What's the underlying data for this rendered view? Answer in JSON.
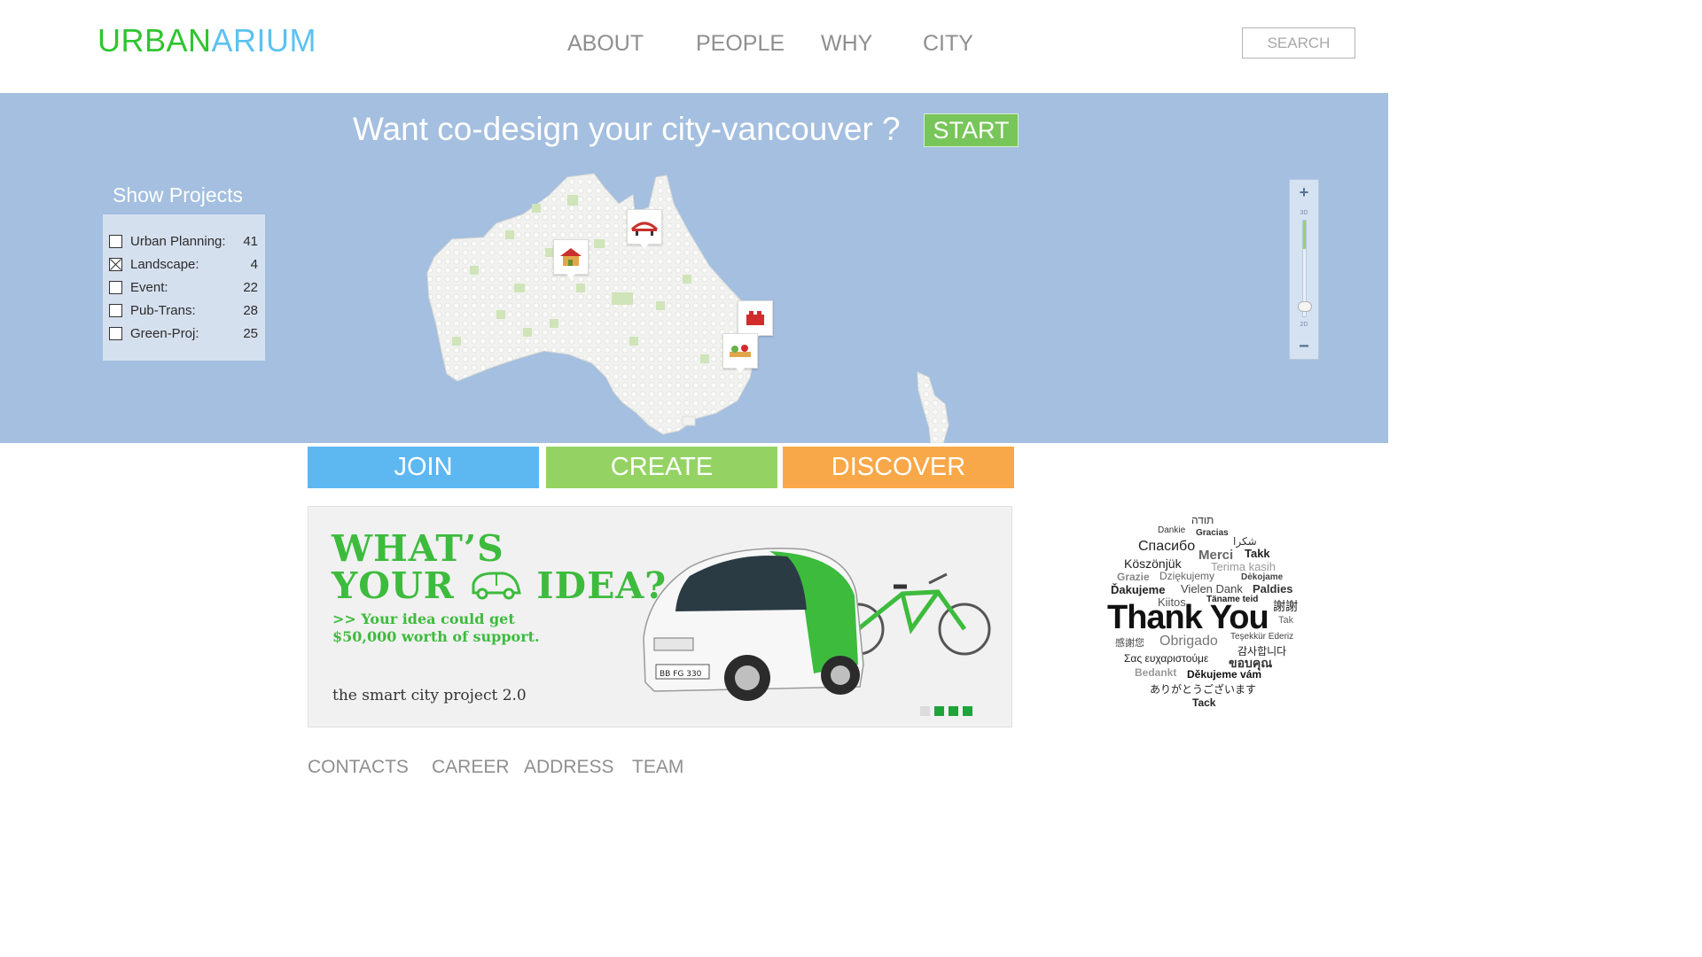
{
  "header": {
    "logo_part1": "URBAN",
    "logo_part2": "ARIUM",
    "nav": [
      "ABOUT",
      "PEOPLE",
      "WHY",
      "CITY"
    ],
    "search_label": "SEARCH"
  },
  "hero": {
    "title": "Want co-design your city-vancouver ?",
    "start_label": "START",
    "panel_title": "Show Projects",
    "projects": [
      {
        "label": "Urban Planning:",
        "count": "41",
        "checked": false
      },
      {
        "label": "Landscape:",
        "count": "4",
        "checked": true
      },
      {
        "label": "Event:",
        "count": "22",
        "checked": false
      },
      {
        "label": "Pub-Trans:",
        "count": "28",
        "checked": false
      },
      {
        "label": "Green-Proj:",
        "count": "25",
        "checked": false
      }
    ],
    "zoom": {
      "plus": "+",
      "minus": "−",
      "label_3d": "3D",
      "label_2d": "2D",
      "level_fraction": 0.9
    }
  },
  "actions": {
    "join": "JOIN",
    "create": "CREATE",
    "discover": "DISCOVER"
  },
  "banner": {
    "line1": "WHAT’S",
    "line2_a": "YOUR",
    "line2_b": "IDEA?",
    "sub1": ">> Your idea could get",
    "sub2": "$50,000 worth of support.",
    "footer": "the smart city project 2.0",
    "plate": "BB FG 330",
    "slide_count": 4,
    "active_slide": 1
  },
  "word_cloud": {
    "words": [
      "תודה",
      "Dankie",
      "Gracias",
      "Спасибо",
      "شكرا",
      "Merci",
      "Takk",
      "Köszönjük",
      "Terima kasih",
      "Grazie",
      "Dziękujemy",
      "Dėkojame",
      "Ďakujeme",
      "Vielen Dank",
      "Paldies",
      "Kiitos",
      "Täname teid",
      "謝謝",
      "Thank You",
      "Tak",
      "感謝您",
      "Obrigado",
      "Teşekkür Ederiz",
      "감사합니다",
      "Σας ευχαριστούμε",
      "ขอบคุณ",
      "Bedankt",
      "Děkujeme vám",
      "ありがとうございます",
      "Tack"
    ]
  },
  "footer": {
    "links": [
      "CONTACTS",
      "CAREER",
      "ADDRESS",
      "TEAM"
    ]
  },
  "colors": {
    "hero_bg": "#a4bfdf",
    "join": "#5db8f2",
    "create": "#94d363",
    "discover": "#f8a848",
    "logo_green": "#2fc52f",
    "logo_blue": "#5cc2f0"
  }
}
